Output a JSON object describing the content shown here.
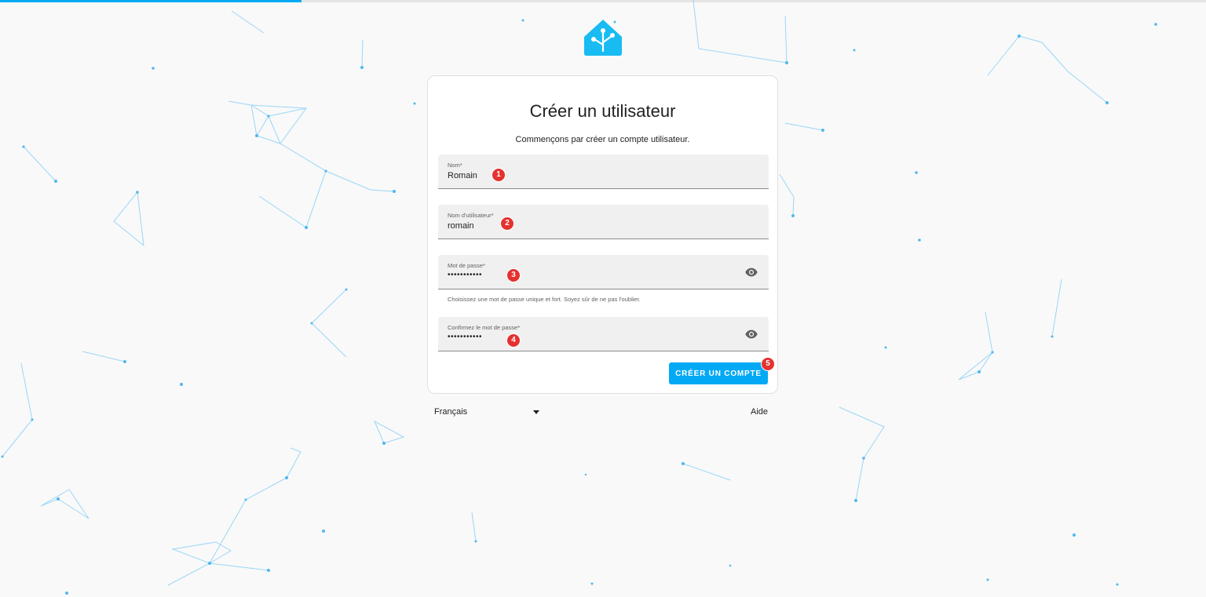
{
  "app": {
    "accent": "#03a9f4",
    "progress": 0.25
  },
  "logo": {
    "icon": "home-assistant-logo-icon"
  },
  "card": {
    "title": "Créer un utilisateur",
    "subtitle": "Commençons par créer un compte utilisateur."
  },
  "fields": [
    {
      "label": "Nom*",
      "value": "Romain"
    },
    {
      "label": "Nom d'utilisateur*",
      "value": "romain"
    },
    {
      "label": "Mot de passe*",
      "value": "•••••••••••",
      "icon": "eye-icon",
      "helper": "Choisissez une mot de passe unique et fort. Soyez sûr de ne pas l'oublier."
    },
    {
      "label": "Confirmez le mot de passe*",
      "value": "•••••••••••",
      "icon": "eye-icon"
    }
  ],
  "badges": [
    "1",
    "2",
    "3",
    "4",
    "5"
  ],
  "badge_color": "#e5312f",
  "submit": {
    "label": "CRÉER UN COMPTE"
  },
  "footer": {
    "language": "Français",
    "help": "Aide"
  }
}
